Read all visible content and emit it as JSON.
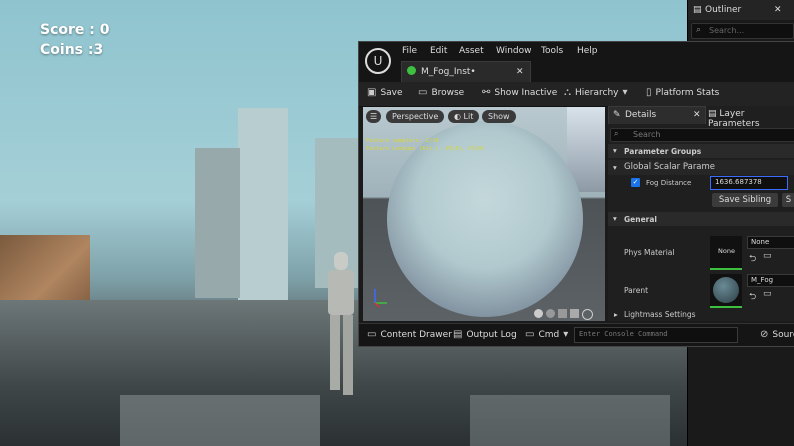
{
  "hud": {
    "score": "Score : 0",
    "coins": "Coins :3"
  },
  "outliner": {
    "title": "Outliner",
    "search_placeholder": "Search..."
  },
  "menu": [
    "File",
    "Edit",
    "Asset",
    "Window",
    "Tools",
    "Help"
  ],
  "asset_tab": {
    "label": "M_Fog_Inst•"
  },
  "toolbar": {
    "save": "Save",
    "browse": "Browse",
    "show_inactive": "Show Inactive",
    "hierarchy": "Hierarchy",
    "platform_stats": "Platform Stats"
  },
  "viewport": {
    "perspective": "Perspective",
    "lit": "Lit",
    "show": "Show",
    "stats_line1": "Texture samplers: 2/16",
    "stats_line2": "Texture Lookups (Est.): VS(0), PS(0)"
  },
  "details": {
    "tab_details": "Details",
    "tab_layer": "Layer Parameters",
    "search_placeholder": "Search",
    "parameter_groups": "Parameter Groups",
    "global_scalar": "Global Scalar Parame",
    "fog_distance_label": "Fog Distance",
    "fog_distance_value": "1636.687378",
    "save_sibling": "Save Sibling",
    "save_child": "S",
    "general": "General",
    "phys_material": "Phys Material",
    "phys_thumb": "None",
    "phys_value": "None",
    "parent": "Parent",
    "parent_value": "M_Fog",
    "lightmass": "Lightmass Settings"
  },
  "status": {
    "content_drawer": "Content Drawer",
    "output_log": "Output Log",
    "cmd": "Cmd",
    "console_placeholder": "Enter Console Command",
    "source": "Sourc"
  },
  "colors": {
    "accent_green": "#3fbf3f",
    "accent_blue": "#1a73e8",
    "panel_bg": "#1b1b1b"
  }
}
